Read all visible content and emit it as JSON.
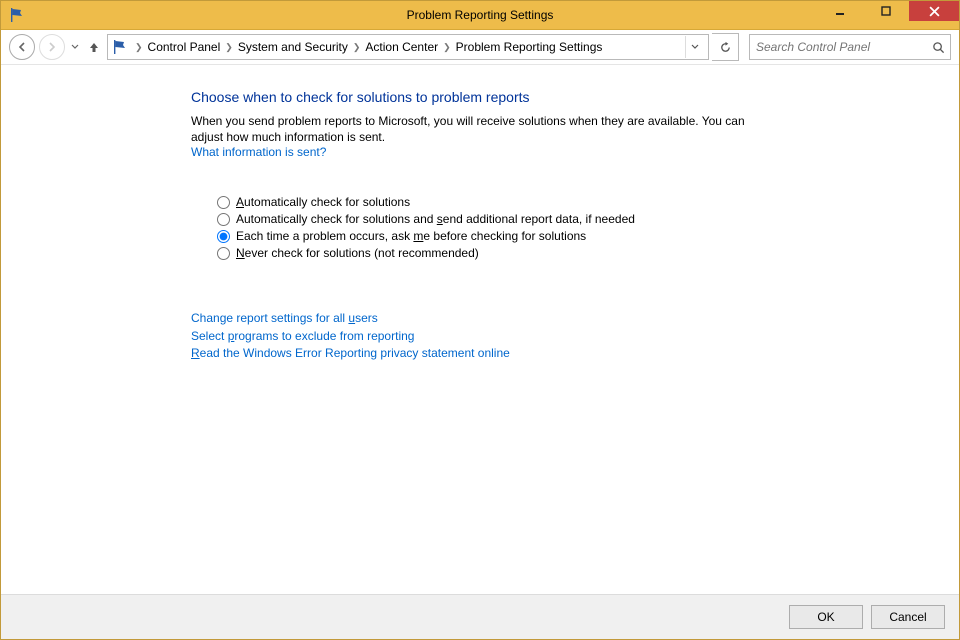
{
  "window": {
    "title": "Problem Reporting Settings",
    "icon": "flag-icon"
  },
  "nav": {
    "back_enabled": true,
    "forward_enabled": false
  },
  "breadcrumbs": [
    "Control Panel",
    "System and Security",
    "Action Center",
    "Problem Reporting Settings"
  ],
  "search": {
    "placeholder": "Search Control Panel"
  },
  "page": {
    "title": "Choose when to check for solutions to problem reports",
    "description": "When you send problem reports to Microsoft, you will receive solutions when they are available. You can adjust how much information is sent.",
    "info_link": "What information is sent?"
  },
  "options": [
    {
      "label_pre": "",
      "underline": "A",
      "label_post": "utomatically check for solutions",
      "checked": false
    },
    {
      "label_pre": "Automatically check for solutions and ",
      "underline": "s",
      "label_post": "end additional report data, if needed",
      "checked": false
    },
    {
      "label_pre": "Each time a problem occurs, ask ",
      "underline": "m",
      "label_post": "e before checking for solutions",
      "checked": true
    },
    {
      "label_pre": "",
      "underline": "N",
      "label_post": "ever check for solutions (not recommended)",
      "checked": false
    }
  ],
  "bottom_links": [
    {
      "pre": "Change report settings for all ",
      "u": "u",
      "post": "sers"
    },
    {
      "pre": "Select ",
      "u": "p",
      "post": "rograms to exclude from reporting"
    },
    {
      "pre": "",
      "u": "R",
      "post": "ead the Windows Error Reporting privacy statement online"
    }
  ],
  "footer": {
    "ok": "OK",
    "cancel": "Cancel"
  }
}
